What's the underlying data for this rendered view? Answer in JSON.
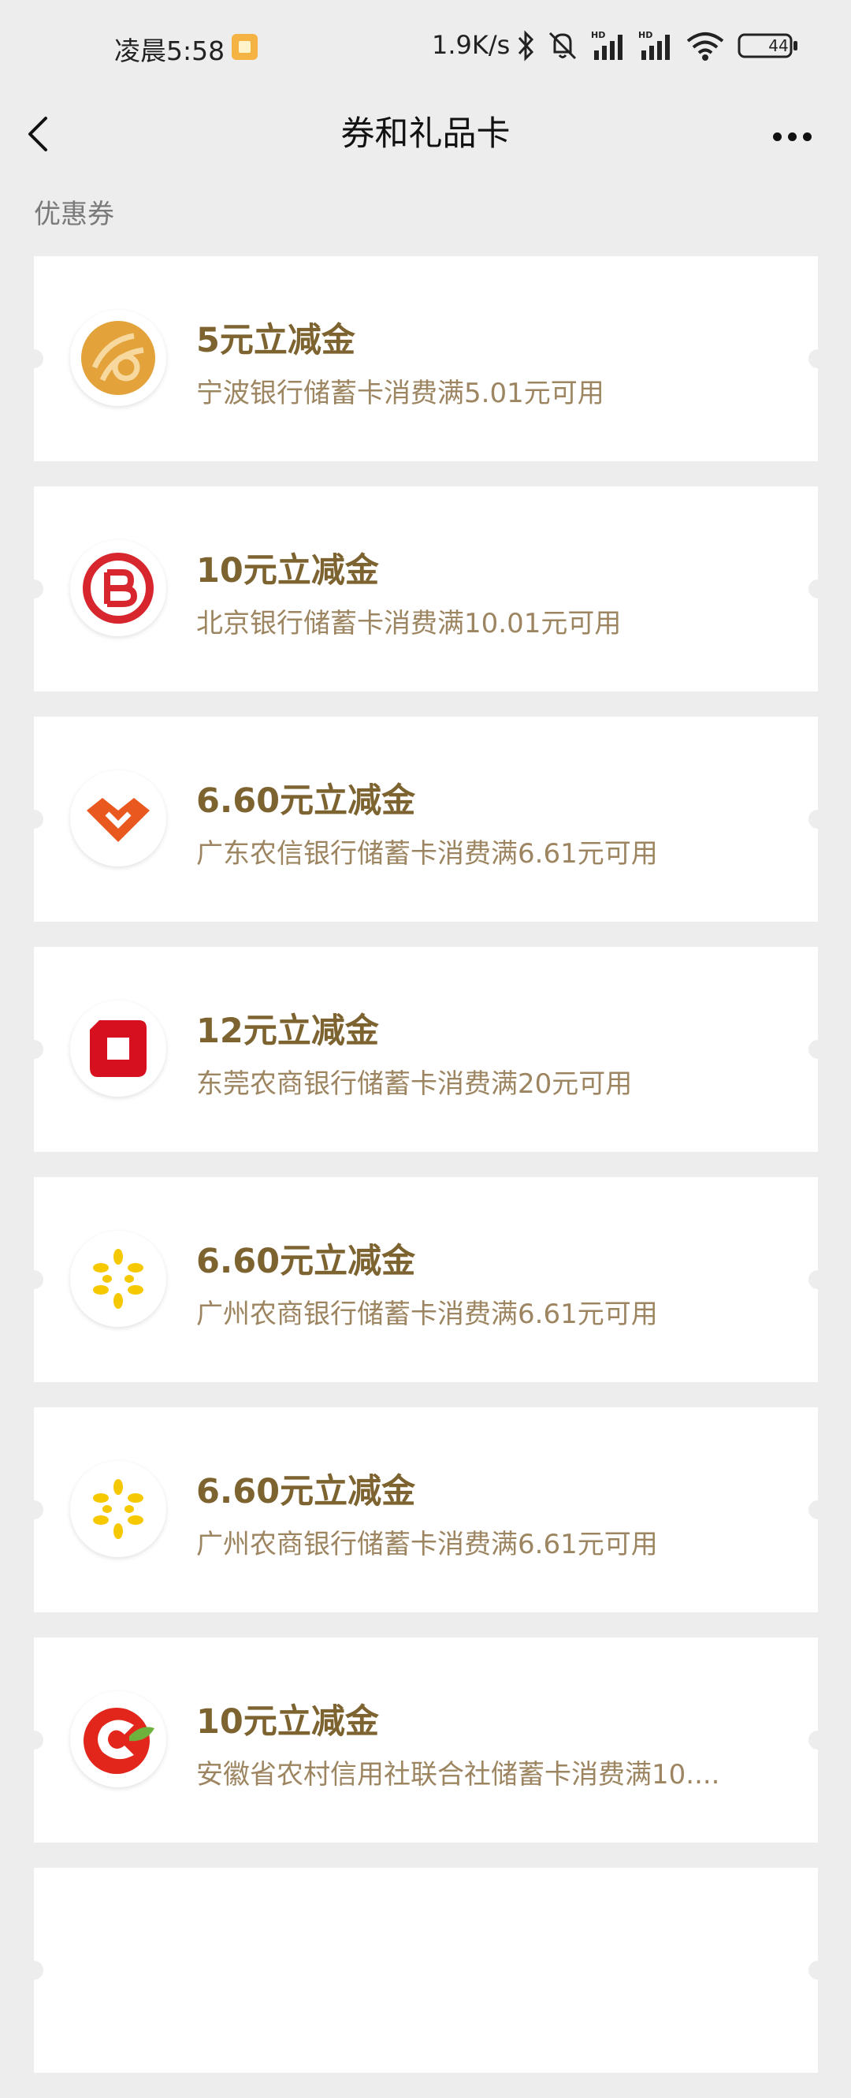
{
  "status_bar": {
    "time": "凌晨5:58",
    "network_speed": "1.9K/s",
    "battery": "44"
  },
  "nav": {
    "title": "券和礼品卡"
  },
  "section": {
    "label": "优惠券"
  },
  "coupons": [
    {
      "title": "5元立减金",
      "desc": "宁波银行储蓄卡消费满5.01元可用",
      "logo": "ningbo-bank-logo"
    },
    {
      "title": "10元立减金",
      "desc": "北京银行储蓄卡消费满10.01元可用",
      "logo": "beijing-bank-logo"
    },
    {
      "title": "6.60元立减金",
      "desc": "广东农信银行储蓄卡消费满6.61元可用",
      "logo": "guangdong-rural-credit-logo"
    },
    {
      "title": "12元立减金",
      "desc": "东莞农商银行储蓄卡消费满20元可用",
      "logo": "dongguan-rural-bank-logo"
    },
    {
      "title": "6.60元立减金",
      "desc": "广州农商银行储蓄卡消费满6.61元可用",
      "logo": "guangzhou-rural-bank-logo"
    },
    {
      "title": "6.60元立减金",
      "desc": "广州农商银行储蓄卡消费满6.61元可用",
      "logo": "guangzhou-rural-bank-logo"
    },
    {
      "title": "10元立减金",
      "desc": "安徽省农村信用社联合社储蓄卡消费满10....",
      "logo": "anhui-rural-credit-logo"
    },
    {
      "title": "",
      "desc": "",
      "logo": ""
    }
  ],
  "colors": {
    "background": "#ededed",
    "coupon_title": "#7d6330",
    "coupon_desc": "#9c8560"
  }
}
